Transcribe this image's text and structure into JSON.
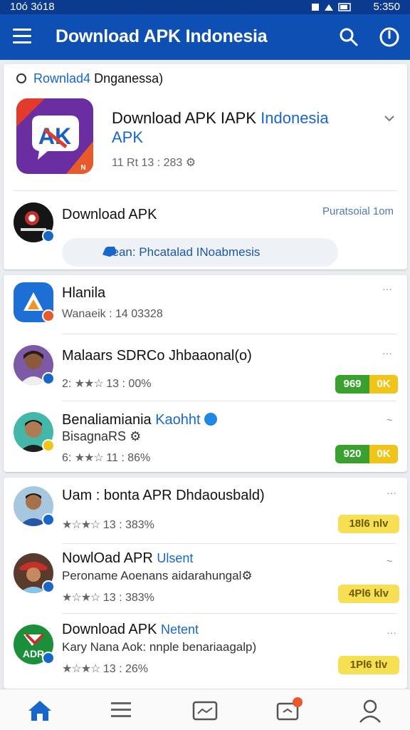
{
  "status": {
    "left": "10ó 3ó18",
    "right": "5:350"
  },
  "appbar": {
    "title": "Download APK Indonesia"
  },
  "featured": {
    "search_prefix": "Rownlad4",
    "search_rest": "Dnganessa)",
    "title_black": "Download APK IAPK",
    "title_blue": "Indonesia",
    "title_line2": "APK",
    "meta": "11 Rt 13 : 283 ",
    "item_name": "Download APK",
    "item_tag": "Puratsoial 1om",
    "search_pill": "sean: Phcatalad INoabmesis"
  },
  "list1": [
    {
      "name": "Hlanila",
      "name_blue": "",
      "sub": "Wanaeik : 14 03328",
      "more": "···"
    },
    {
      "name": "Malaars SDRCo  Jhbaaonal(o)",
      "name_blue": "",
      "stars": "★★☆",
      "rating_prefix": "2: ",
      "rating": "13 : 00%",
      "pill_main": "969",
      "pill_half": "0K",
      "more": "···"
    },
    {
      "name": "Benaliamiania",
      "name_blue": "Kaohht",
      "sub": "BisagnaRS",
      "stars": "★★☆",
      "rating_prefix": "6: ",
      "rating": "11 : 86%",
      "pill_main": "920",
      "pill_half": "0K",
      "more": "~"
    }
  ],
  "list2": [
    {
      "name": "Uam : bonta  APR Dhdaousbald)",
      "stars": "★☆★☆",
      "rating": "13 : 383%",
      "pill": "18l6 nlv",
      "more": "···"
    },
    {
      "name": "NowlOad APR",
      "name_blue": "Ulsent",
      "sub": "Peroname Aoenans aidarahungal",
      "stars": "★☆★☆",
      "rating": "13 : 383%",
      "pill": "4Pl6 klv",
      "more": "~"
    },
    {
      "name": "Download APK",
      "name_blue": "Netent",
      "sub": "Kary Nana Aok: nnple benariaagalp)",
      "stars": "★☆★☆",
      "rating": "13 : 26%",
      "pill": "1Pl6 tlv",
      "more": "···"
    }
  ],
  "colors": {
    "appbar": "#0d4fb2",
    "accent": "#1766c9",
    "green": "#3aa12e",
    "yellow": "#f6df53"
  }
}
